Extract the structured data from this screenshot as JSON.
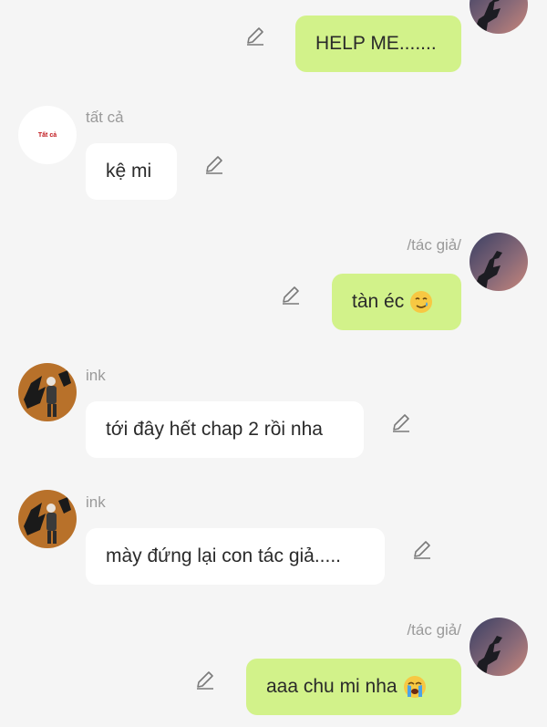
{
  "messages": [
    {
      "side": "mine",
      "sender": "",
      "text": "HELP ME.......",
      "avatar": "author-avatar"
    },
    {
      "side": "theirs",
      "sender": "tất cả",
      "text": "kệ mi",
      "avatar": "tat-ca-avatar",
      "avatar_text": "Tất cả"
    },
    {
      "side": "mine",
      "sender": "/tác giả/",
      "text": "tàn éc",
      "emoji": "smiling-face-with-tear",
      "avatar": "author-avatar"
    },
    {
      "side": "theirs",
      "sender": "ink",
      "text": "tới đây hết chap 2 rồi nha",
      "avatar": "ink-avatar"
    },
    {
      "side": "theirs",
      "sender": "ink",
      "text": "mày đứng lại con tác giả.....",
      "avatar": "ink-avatar"
    },
    {
      "side": "mine",
      "sender": "/tác giả/",
      "text": "aaa chu mi nha",
      "emoji": "loudly-crying-face",
      "avatar": "author-avatar"
    }
  ],
  "icons": {
    "edit": "pencil-edit-icon"
  },
  "colors": {
    "background": "#f5f5f5",
    "my_bubble": "#d2f28a",
    "their_bubble": "#ffffff",
    "sender_text": "#9a9a9a",
    "avatar_tat_ca_text": "#c0161b"
  }
}
